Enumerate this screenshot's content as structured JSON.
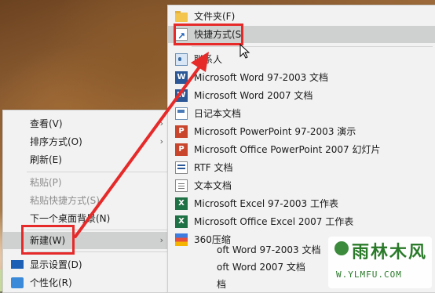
{
  "context_menu": {
    "items": [
      {
        "label": "查看(V)",
        "arrow": "›"
      },
      {
        "label": "排序方式(O)",
        "arrow": "›"
      },
      {
        "label": "刷新(E)"
      },
      {
        "label": "粘贴(P)"
      },
      {
        "label": "粘贴快捷方式(S)"
      },
      {
        "label": "下一个桌面背景(N)"
      },
      {
        "label": "新建(W)",
        "arrow": "›"
      },
      {
        "label": "显示设置(D)"
      },
      {
        "label": "个性化(R)"
      }
    ]
  },
  "new_submenu": {
    "items": [
      {
        "label": "文件夹(F)",
        "icon": "folder-icon"
      },
      {
        "label": "快捷方式(S",
        "icon": "shortcut-icon"
      },
      {
        "label": "联系人",
        "icon": "contact-icon"
      },
      {
        "label": "Microsoft Word 97-2003 文档",
        "icon": "word-icon",
        "glyph": "W"
      },
      {
        "label": "Microsoft Word 2007 文档",
        "icon": "word-icon",
        "glyph": "W"
      },
      {
        "label": "日记本文档",
        "icon": "journal-icon"
      },
      {
        "label": "Microsoft PowerPoint 97-2003 演示",
        "icon": "powerpoint-icon",
        "glyph": "P"
      },
      {
        "label": "Microsoft Office PowerPoint 2007 幻灯片",
        "icon": "powerpoint-icon",
        "glyph": "P"
      },
      {
        "label": "RTF 文档",
        "icon": "rtf-icon"
      },
      {
        "label": "文本文档",
        "icon": "text-document-icon"
      },
      {
        "label": "Microsoft Excel 97-2003 工作表",
        "icon": "excel-icon",
        "glyph": "X"
      },
      {
        "label": "Microsoft Office Excel 2007 工作表",
        "icon": "excel-icon",
        "glyph": "X"
      },
      {
        "label": "360压缩",
        "icon": "archive-icon"
      }
    ]
  },
  "background_menu_ghost": [
    "oft Word 97-2003 文档",
    "oft Word 2007 文档",
    "档"
  ],
  "watermark": {
    "title": "雨林木风",
    "url": "W.YLMFU.COM"
  },
  "colors": {
    "annotation_red": "#e62a2a",
    "menu_bg": "#f2f2f2",
    "highlight": "#cfd0d0"
  }
}
